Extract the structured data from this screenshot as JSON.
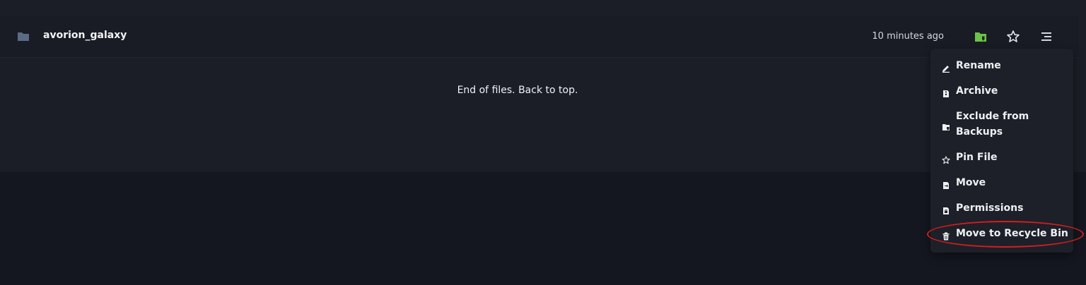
{
  "file_row": {
    "name": "avorion_galaxy",
    "modified": "10 minutes ago",
    "icons": {
      "folder": "folder-icon",
      "backup": "folder-shield-icon",
      "pin": "star-icon",
      "menu": "menu-icon"
    },
    "backup_icon_color": "#6cc24a"
  },
  "list_footer": {
    "text": "End of files. Back to top."
  },
  "context_menu": {
    "items": [
      {
        "label": "Rename",
        "icon": "pencil-icon"
      },
      {
        "label": "Archive",
        "icon": "archive-file-icon"
      },
      {
        "label": "Exclude from Backups",
        "label_line1": "Exclude from",
        "label_line2": "Backups",
        "icon": "folder-shield-icon"
      },
      {
        "label": "Pin File",
        "icon": "star-icon"
      },
      {
        "label": "Move",
        "icon": "move-file-icon"
      },
      {
        "label": "Permissions",
        "icon": "lock-file-icon"
      },
      {
        "label": "Move to Recycle Bin",
        "icon": "trash-icon"
      }
    ]
  },
  "annotation": {
    "highlight_color": "#d21e1e"
  }
}
